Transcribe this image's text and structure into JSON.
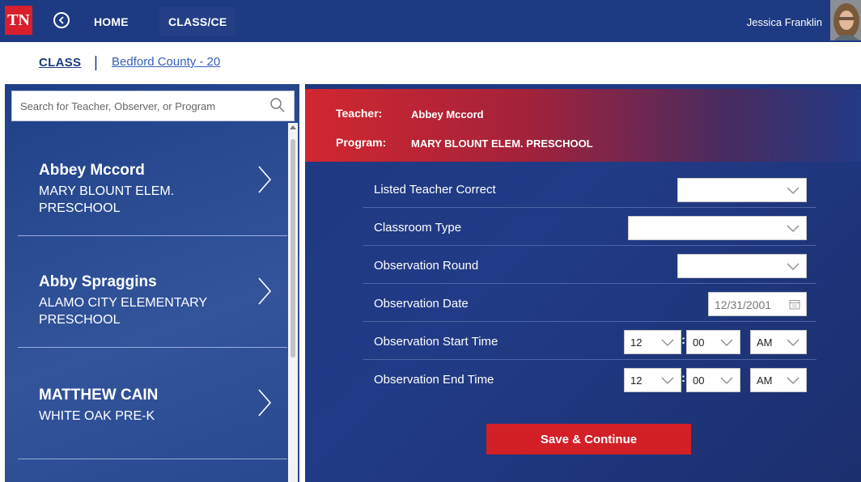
{
  "topbar": {
    "logo_text": "TN",
    "home_label": "HOME",
    "class_label": "CLASS/CE",
    "user_name": "Jessica Franklin",
    "colors": {
      "bar": "#1d3a82",
      "logo": "#d81f2b"
    }
  },
  "breadcrumb": {
    "class_label": "CLASS",
    "separator": "|",
    "county_label": "Bedford County - 20"
  },
  "search": {
    "placeholder": "Search for Teacher, Observer, or Program"
  },
  "list": {
    "items": [
      {
        "name": "Abbey Mccord",
        "program": "MARY BLOUNT ELEM. PRESCHOOL"
      },
      {
        "name": "Abby Spraggins",
        "program": "ALAMO CITY ELEMENTARY PRESCHOOL"
      },
      {
        "name": "MATTHEW CAIN",
        "program": "WHITE OAK PRE-K"
      }
    ]
  },
  "header": {
    "teacher_label": "Teacher:",
    "teacher_value": "Abbey Mccord",
    "program_label": "Program:",
    "program_value": "MARY BLOUNT ELEM. PRESCHOOL"
  },
  "form": {
    "listed_teacher_label": "Listed Teacher Correct",
    "listed_teacher_value": "",
    "classroom_type_label": "Classroom Type",
    "classroom_type_value": "",
    "observation_round_label": "Observation Round",
    "observation_round_value": "",
    "observation_date_label": "Observation Date",
    "observation_date_placeholder": "12/31/2001",
    "start_time_label": "Observation Start Time",
    "start_hour": "12",
    "start_minute": "00",
    "start_ampm": "AM",
    "end_time_label": "Observation End Time",
    "end_hour": "12",
    "end_minute": "00",
    "end_ampm": "AM",
    "time_separator": ":"
  },
  "actions": {
    "save_label": "Save & Continue",
    "save_color": "#d31f26"
  }
}
